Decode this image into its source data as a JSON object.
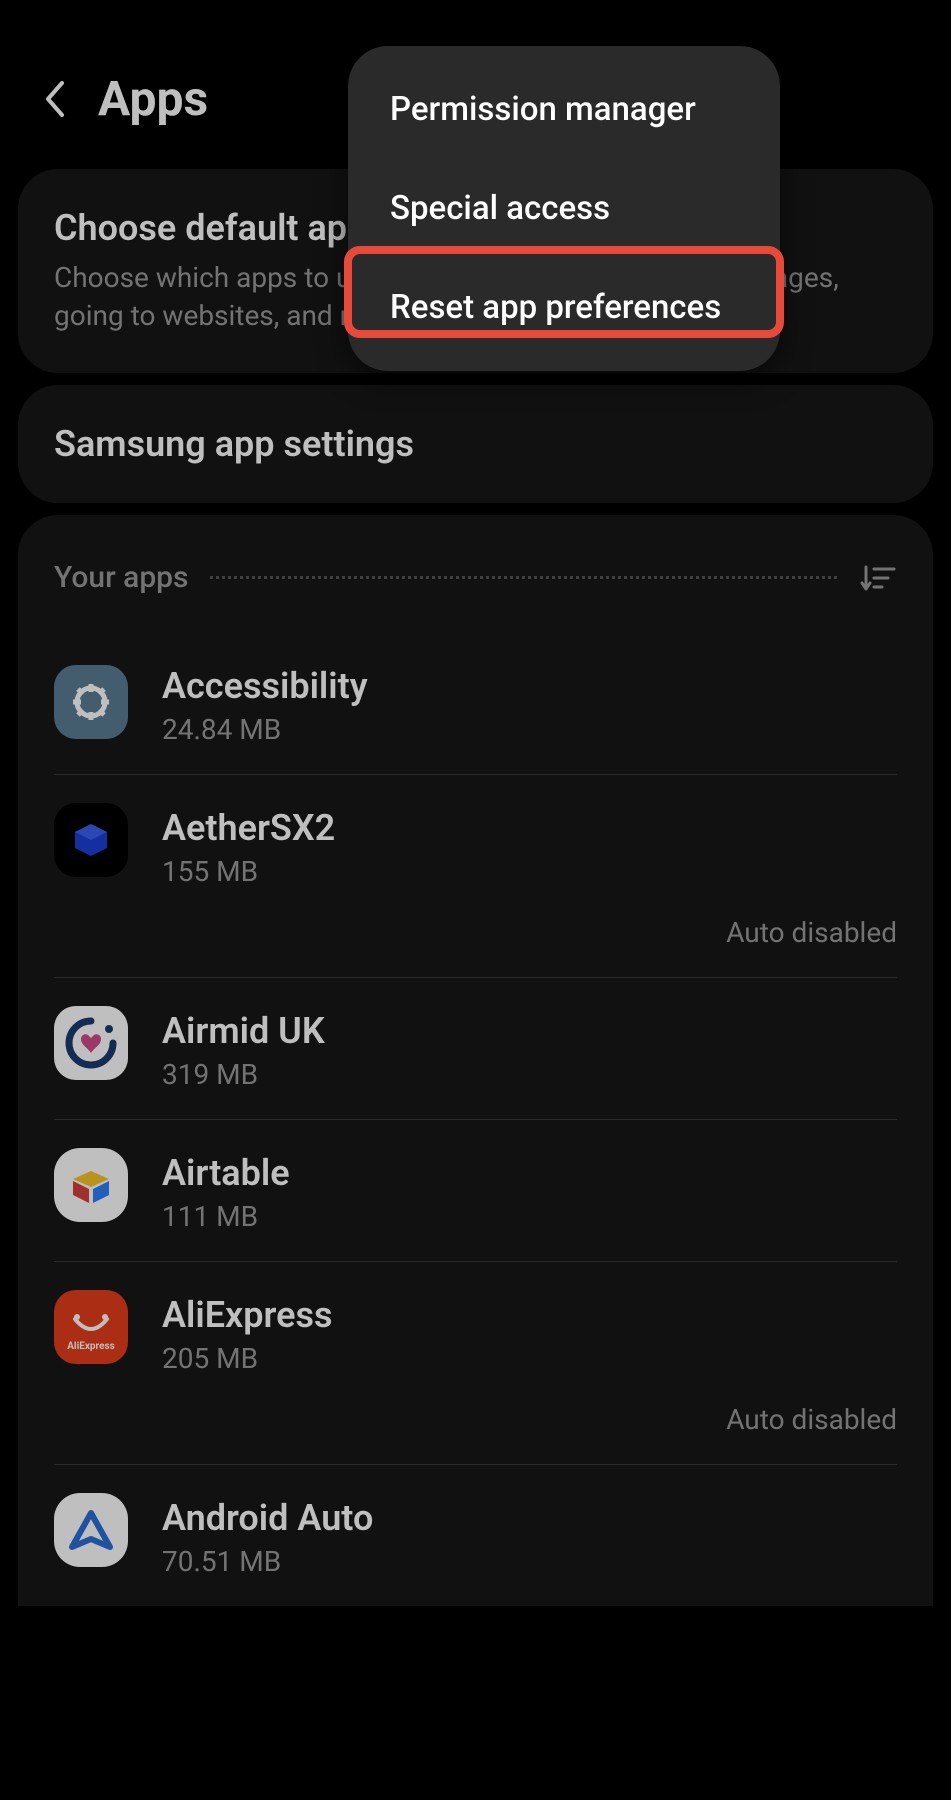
{
  "header": {
    "title": "Apps"
  },
  "defaultAppsCard": {
    "title": "Choose default apps",
    "subtitle": "Choose which apps to use for making calls, sending messages, going to websites, and more."
  },
  "samsungCard": {
    "title": "Samsung app settings"
  },
  "appsSection": {
    "label": "Your apps"
  },
  "apps": [
    {
      "name": "Accessibility",
      "size": "24.84 MB",
      "status": ""
    },
    {
      "name": "AetherSX2",
      "size": "155 MB",
      "status": "Auto disabled"
    },
    {
      "name": "Airmid UK",
      "size": "319 MB",
      "status": ""
    },
    {
      "name": "Airtable",
      "size": "111 MB",
      "status": ""
    },
    {
      "name": "AliExpress",
      "size": "205 MB",
      "status": "Auto disabled"
    },
    {
      "name": "Android Auto",
      "size": "70.51 MB",
      "status": ""
    }
  ],
  "menu": {
    "items": [
      "Permission manager",
      "Special access",
      "Reset app preferences"
    ]
  }
}
